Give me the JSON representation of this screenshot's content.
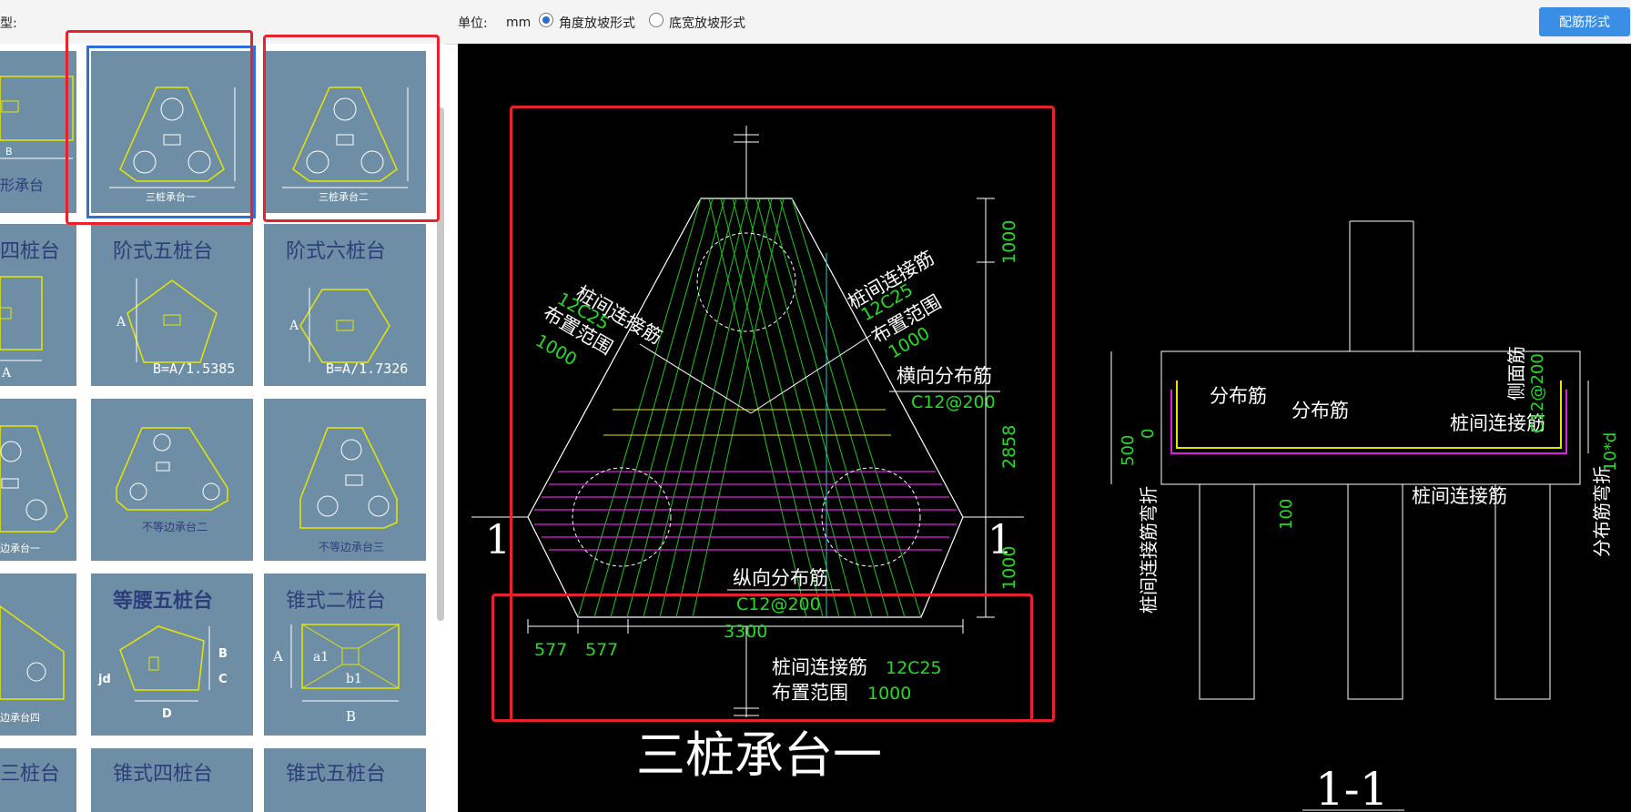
{
  "toolbar": {
    "type_label": "型:",
    "unit_label": "单位:",
    "unit_value": "mm",
    "slope_options": [
      "角度放坡形式",
      "底宽放坡形式"
    ],
    "slope_selected": "角度放坡形式",
    "config_button": "配筋形式"
  },
  "templates": {
    "row1": [
      "形承台",
      "三桩承台一",
      "三桩承台二"
    ],
    "row2": [
      "四桩台",
      "阶式五桩台",
      "阶式六桩台"
    ],
    "row2_formulas": [
      "B=A/1.5385",
      "B=A/1.7326"
    ],
    "row3": [
      "边承台一",
      "不等边承台二",
      "不等边承台三"
    ],
    "row4": [
      "边承台四",
      "等腰五桩台",
      "锥式二桩台"
    ],
    "row5": [
      "三桩台",
      "锥式四桩台",
      "锥式五桩台"
    ],
    "misc_labels": {
      "A": "A",
      "B": "B",
      "C": "C",
      "D": "D",
      "jd": "jd",
      "a1": "a1",
      "b1": "b1"
    }
  },
  "drawing": {
    "title": "三桩承台一",
    "section_title": "1-1",
    "section_mark": "1",
    "labels": {
      "conn_left": "桩间连接筋",
      "conn_left_spec": "12C25",
      "range_left": "布置范围",
      "range_left_val": "1000",
      "conn_right": "桩间连接筋",
      "conn_right_spec": "12C25",
      "range_right": "布置范围",
      "range_right_val": "1000",
      "transverse": "横向分布筋",
      "transverse_spec": "C12@200",
      "longitudinal": "纵向分布筋",
      "longitudinal_spec": "C12@200",
      "bottom_conn": "桩间连接筋",
      "bottom_conn_spec": "12C25",
      "bottom_range": "布置范围",
      "bottom_range_val": "1000"
    },
    "dims": {
      "right": [
        "1000",
        "2858",
        "1000"
      ],
      "bottom": [
        "577",
        "577",
        "3300"
      ]
    },
    "section": {
      "dist1": "分布筋",
      "dist2": "分布筋",
      "side": "侧面筋",
      "side_spec": "C12@200",
      "pile_conn": "桩间连接筋",
      "pile_conn2": "桩间连接筋",
      "left_vertical": "桩间连接筋弯折",
      "right_vertical": "分布筋弯折",
      "dim_500": "500",
      "dim_0": "0",
      "dim_100": "100",
      "dim_10d": "10*d"
    }
  },
  "colors": {
    "accent": "#3a8ee6",
    "highlight": "#e8222a",
    "selected": "#2c72d6",
    "rebar_green": "#22dd22",
    "rebar_magenta": "#e020e0",
    "outline_yellow": "#e6e600"
  }
}
